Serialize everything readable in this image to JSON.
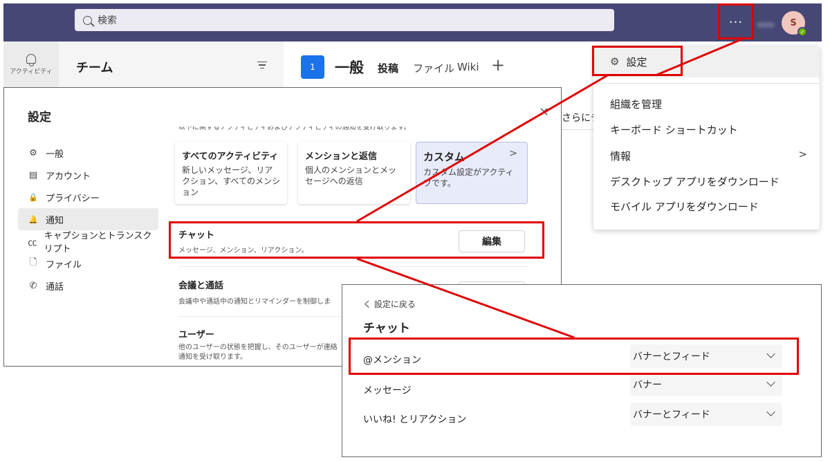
{
  "topbar": {
    "search_placeholder": "検索",
    "more_label": "···",
    "avatar_initial": "S",
    "status_icon": "✓"
  },
  "rail": {
    "activity_label": "アクティビティ"
  },
  "teams": {
    "title": "チーム"
  },
  "channel": {
    "number": "1",
    "name": "一般",
    "tabs": [
      "投稿",
      "ファイル",
      "Wiki"
    ],
    "add": "+",
    "peek_text": "さらにチー"
  },
  "menu": {
    "settings": "設定",
    "items": [
      "組織を管理",
      "キーボード ショートカット",
      "情報",
      "デスクトップ アプリをダウンロード",
      "モバイル アプリをダウンロード"
    ],
    "chevron": ">"
  },
  "settings_dialog": {
    "title": "設定",
    "close": "×",
    "nav": [
      {
        "icon": "gear-icon",
        "glyph": "⚙",
        "label": "一般"
      },
      {
        "icon": "id-card-icon",
        "glyph": "▤",
        "label": "アカウント"
      },
      {
        "icon": "lock-icon",
        "glyph": "🔒",
        "label": "プライバシー"
      },
      {
        "icon": "bell-icon",
        "glyph": "🔔",
        "label": "通知"
      },
      {
        "icon": "cc-icon",
        "glyph": "㏄",
        "label": "キャプションとトランスクリプト"
      },
      {
        "icon": "file-icon",
        "glyph": "🗋",
        "label": "ファイル"
      },
      {
        "icon": "phone-icon",
        "glyph": "✆",
        "label": "通話"
      }
    ],
    "cut_text": "以下に関するアクティビティおよびアクティビティの通知を受け取ります。",
    "cards": [
      {
        "title": "すべてのアクティビティ",
        "desc": "新しいメッセージ、リアクション、すべてのメンション"
      },
      {
        "title": "メンションと返信",
        "desc": "個人のメンションとメッセージへの返信"
      },
      {
        "title": "カスタム",
        "desc": "カスタム設定がアクティブです。",
        "chevron": ">"
      }
    ],
    "sections": [
      {
        "title": "チャット",
        "desc": "メッセージ、メンション、リアクション。"
      },
      {
        "title": "会議と通話",
        "desc": "会議中や通話中の通知とリマインダーを制御しま"
      },
      {
        "title": "ユーザー",
        "desc": "他のユーザーの状態を把握し、そのユーザーが連絡",
        "desc2": "通知を受け取ります。"
      }
    ],
    "edit_label": "編集"
  },
  "chat_panel": {
    "back": "く 設定に戻る",
    "title": "チャット",
    "rows": [
      {
        "label": "@メンション",
        "value": "バナーとフィード"
      },
      {
        "label": "メッセージ",
        "value": "バナー"
      },
      {
        "label": "いいね! とリアクション",
        "value": "バナーとフィード"
      }
    ]
  },
  "colors": {
    "topbar": "#464775",
    "highlight": "#e00000",
    "channel_badge": "#1a73e8",
    "selected_card": "#e8ebfa"
  }
}
